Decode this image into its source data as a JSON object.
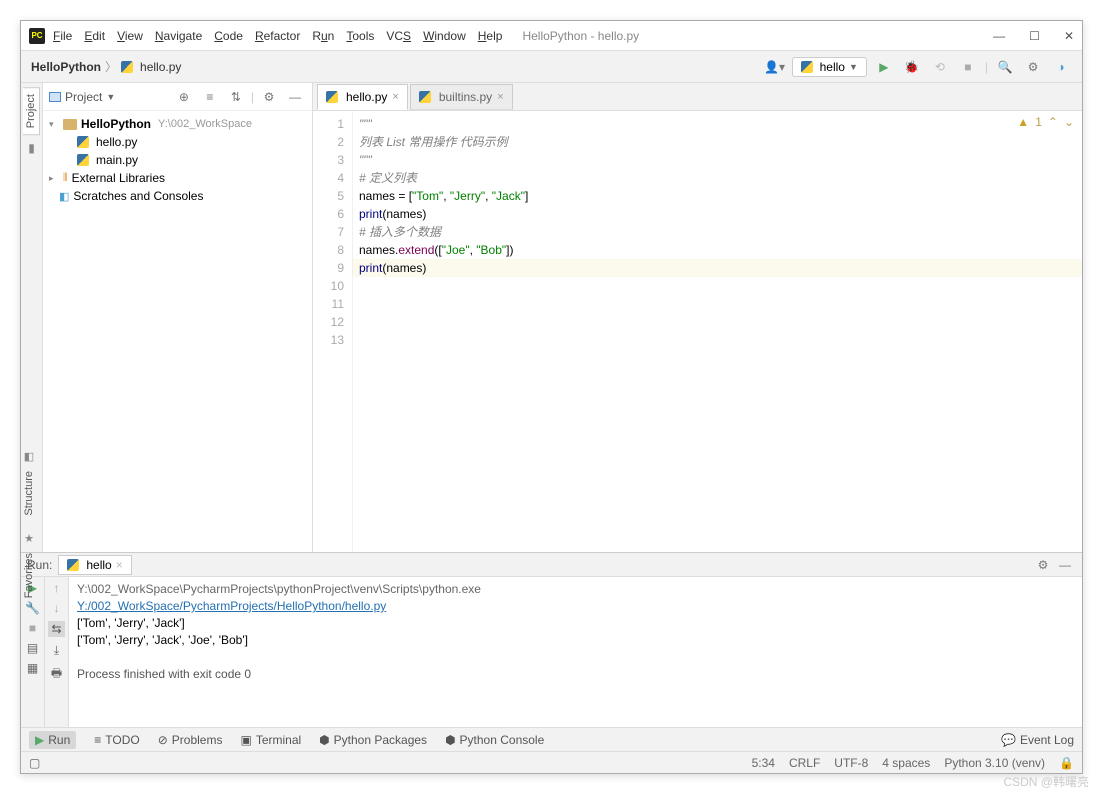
{
  "menu": [
    "File",
    "Edit",
    "View",
    "Navigate",
    "Code",
    "Refactor",
    "Run",
    "Tools",
    "VCS",
    "Window",
    "Help"
  ],
  "window_title": "HelloPython - hello.py",
  "breadcrumb": {
    "root": "HelloPython",
    "file": "hello.py"
  },
  "run_config": "hello",
  "project_header": "Project",
  "tree": {
    "root": "HelloPython",
    "root_path": "Y:\\002_WorkSpace",
    "files": [
      "hello.py",
      "main.py"
    ],
    "ext_lib": "External Libraries",
    "scratch": "Scratches and Consoles"
  },
  "tabs": [
    "hello.py",
    "builtins.py"
  ],
  "code_lines": [
    "\"\"\"",
    "列表 List 常用操作 代码示例",
    "\"\"\"",
    "",
    "# 定义列表",
    "names = [\"Tom\", \"Jerry\", \"Jack\"]",
    "",
    "print(names)",
    "",
    "# 插入多个数据",
    "names.extend([\"Joe\", \"Bob\"])",
    "",
    "print(names)"
  ],
  "warn_count": "1",
  "run": {
    "label": "Run:",
    "tab": "hello",
    "output": [
      "Y:\\002_WorkSpace\\PycharmProjects\\pythonProject\\venv\\Scripts\\python.exe",
      " Y:/002_WorkSpace/PycharmProjects/HelloPython/hello.py",
      "['Tom', 'Jerry', 'Jack']",
      "['Tom', 'Jerry', 'Jack', 'Joe', 'Bob']",
      "",
      "Process finished with exit code 0"
    ]
  },
  "tools": [
    "Run",
    "TODO",
    "Problems",
    "Terminal",
    "Python Packages",
    "Python Console"
  ],
  "event_log": "Event Log",
  "status": {
    "pos": "5:34",
    "eol": "CRLF",
    "enc": "UTF-8",
    "indent": "4 spaces",
    "int": "Python 3.10 (venv)"
  },
  "watermark": "CSDN @韩曙亮",
  "side_tabs": [
    "Project",
    "Structure",
    "Favorites"
  ]
}
